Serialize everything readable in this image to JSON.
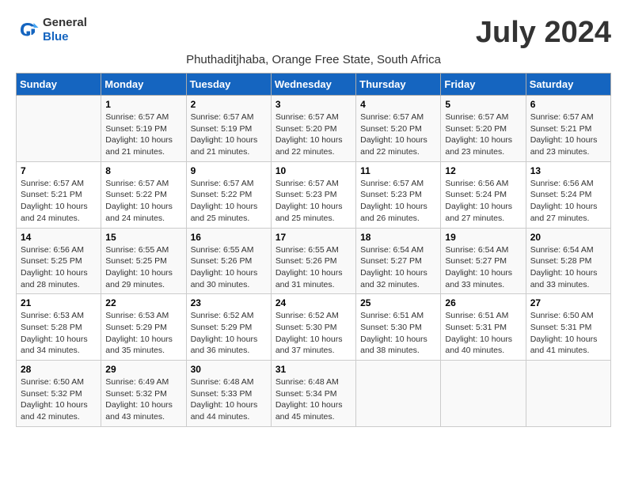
{
  "logo": {
    "general": "General",
    "blue": "Blue"
  },
  "title": "July 2024",
  "subtitle": "Phuthaditjhaba, Orange Free State, South Africa",
  "days_of_week": [
    "Sunday",
    "Monday",
    "Tuesday",
    "Wednesday",
    "Thursday",
    "Friday",
    "Saturday"
  ],
  "weeks": [
    [
      {
        "day": "",
        "info": ""
      },
      {
        "day": "1",
        "info": "Sunrise: 6:57 AM\nSunset: 5:19 PM\nDaylight: 10 hours\nand 21 minutes."
      },
      {
        "day": "2",
        "info": "Sunrise: 6:57 AM\nSunset: 5:19 PM\nDaylight: 10 hours\nand 21 minutes."
      },
      {
        "day": "3",
        "info": "Sunrise: 6:57 AM\nSunset: 5:20 PM\nDaylight: 10 hours\nand 22 minutes."
      },
      {
        "day": "4",
        "info": "Sunrise: 6:57 AM\nSunset: 5:20 PM\nDaylight: 10 hours\nand 22 minutes."
      },
      {
        "day": "5",
        "info": "Sunrise: 6:57 AM\nSunset: 5:20 PM\nDaylight: 10 hours\nand 23 minutes."
      },
      {
        "day": "6",
        "info": "Sunrise: 6:57 AM\nSunset: 5:21 PM\nDaylight: 10 hours\nand 23 minutes."
      }
    ],
    [
      {
        "day": "7",
        "info": "Sunrise: 6:57 AM\nSunset: 5:21 PM\nDaylight: 10 hours\nand 24 minutes."
      },
      {
        "day": "8",
        "info": "Sunrise: 6:57 AM\nSunset: 5:22 PM\nDaylight: 10 hours\nand 24 minutes."
      },
      {
        "day": "9",
        "info": "Sunrise: 6:57 AM\nSunset: 5:22 PM\nDaylight: 10 hours\nand 25 minutes."
      },
      {
        "day": "10",
        "info": "Sunrise: 6:57 AM\nSunset: 5:23 PM\nDaylight: 10 hours\nand 25 minutes."
      },
      {
        "day": "11",
        "info": "Sunrise: 6:57 AM\nSunset: 5:23 PM\nDaylight: 10 hours\nand 26 minutes."
      },
      {
        "day": "12",
        "info": "Sunrise: 6:56 AM\nSunset: 5:24 PM\nDaylight: 10 hours\nand 27 minutes."
      },
      {
        "day": "13",
        "info": "Sunrise: 6:56 AM\nSunset: 5:24 PM\nDaylight: 10 hours\nand 27 minutes."
      }
    ],
    [
      {
        "day": "14",
        "info": "Sunrise: 6:56 AM\nSunset: 5:25 PM\nDaylight: 10 hours\nand 28 minutes."
      },
      {
        "day": "15",
        "info": "Sunrise: 6:55 AM\nSunset: 5:25 PM\nDaylight: 10 hours\nand 29 minutes."
      },
      {
        "day": "16",
        "info": "Sunrise: 6:55 AM\nSunset: 5:26 PM\nDaylight: 10 hours\nand 30 minutes."
      },
      {
        "day": "17",
        "info": "Sunrise: 6:55 AM\nSunset: 5:26 PM\nDaylight: 10 hours\nand 31 minutes."
      },
      {
        "day": "18",
        "info": "Sunrise: 6:54 AM\nSunset: 5:27 PM\nDaylight: 10 hours\nand 32 minutes."
      },
      {
        "day": "19",
        "info": "Sunrise: 6:54 AM\nSunset: 5:27 PM\nDaylight: 10 hours\nand 33 minutes."
      },
      {
        "day": "20",
        "info": "Sunrise: 6:54 AM\nSunset: 5:28 PM\nDaylight: 10 hours\nand 33 minutes."
      }
    ],
    [
      {
        "day": "21",
        "info": "Sunrise: 6:53 AM\nSunset: 5:28 PM\nDaylight: 10 hours\nand 34 minutes."
      },
      {
        "day": "22",
        "info": "Sunrise: 6:53 AM\nSunset: 5:29 PM\nDaylight: 10 hours\nand 35 minutes."
      },
      {
        "day": "23",
        "info": "Sunrise: 6:52 AM\nSunset: 5:29 PM\nDaylight: 10 hours\nand 36 minutes."
      },
      {
        "day": "24",
        "info": "Sunrise: 6:52 AM\nSunset: 5:30 PM\nDaylight: 10 hours\nand 37 minutes."
      },
      {
        "day": "25",
        "info": "Sunrise: 6:51 AM\nSunset: 5:30 PM\nDaylight: 10 hours\nand 38 minutes."
      },
      {
        "day": "26",
        "info": "Sunrise: 6:51 AM\nSunset: 5:31 PM\nDaylight: 10 hours\nand 40 minutes."
      },
      {
        "day": "27",
        "info": "Sunrise: 6:50 AM\nSunset: 5:31 PM\nDaylight: 10 hours\nand 41 minutes."
      }
    ],
    [
      {
        "day": "28",
        "info": "Sunrise: 6:50 AM\nSunset: 5:32 PM\nDaylight: 10 hours\nand 42 minutes."
      },
      {
        "day": "29",
        "info": "Sunrise: 6:49 AM\nSunset: 5:32 PM\nDaylight: 10 hours\nand 43 minutes."
      },
      {
        "day": "30",
        "info": "Sunrise: 6:48 AM\nSunset: 5:33 PM\nDaylight: 10 hours\nand 44 minutes."
      },
      {
        "day": "31",
        "info": "Sunrise: 6:48 AM\nSunset: 5:34 PM\nDaylight: 10 hours\nand 45 minutes."
      },
      {
        "day": "",
        "info": ""
      },
      {
        "day": "",
        "info": ""
      },
      {
        "day": "",
        "info": ""
      }
    ]
  ]
}
